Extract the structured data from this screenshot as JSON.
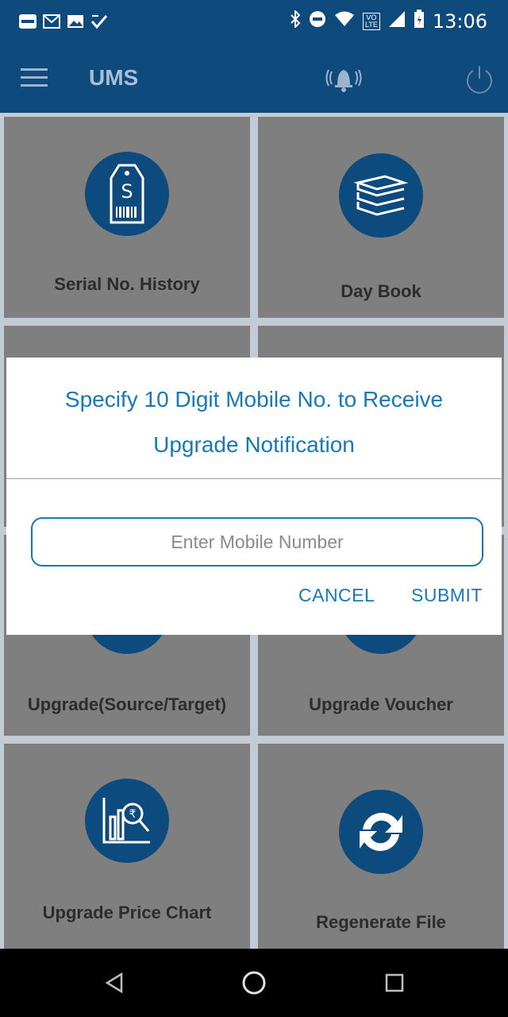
{
  "status_bar": {
    "time": "13:06",
    "left_icons": [
      "paytm-icon",
      "gmail-icon",
      "gallery-icon",
      "checkmark-icon"
    ],
    "volte_text": "VO\nLTE"
  },
  "app_bar": {
    "title": "UMS"
  },
  "tiles": [
    {
      "label": "Serial No. History",
      "icon": "price-tag-icon"
    },
    {
      "label": "Day Book",
      "icon": "books-icon"
    },
    {
      "label": "Upgrade(Source/Target)",
      "icon": "upgrade-icon"
    },
    {
      "label": "Upgrade Voucher",
      "icon": "voucher-icon"
    },
    {
      "label": "Upgrade Price Chart",
      "icon": "price-chart-icon"
    },
    {
      "label": "Regenerate File",
      "icon": "refresh-icon"
    }
  ],
  "dialog": {
    "title_line1": "Specify 10 Digit Mobile No. to Receive",
    "title_line2": "Upgrade Notification",
    "input_placeholder": "Enter Mobile Number",
    "input_value": "",
    "cancel_label": "CANCEL",
    "submit_label": "SUBMIT"
  },
  "colors": {
    "primary": "#0f4a7d",
    "accent": "#1779b8"
  }
}
